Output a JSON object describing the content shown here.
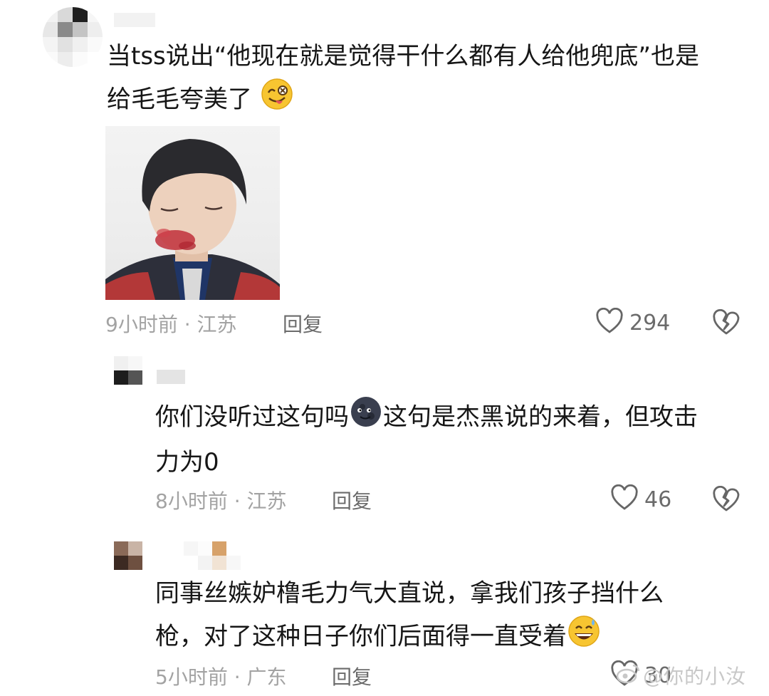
{
  "comments": [
    {
      "text_lines": [
        "当tss说出“他现在就是觉得干什么都有人给他兜底”也是",
        "给毛毛夸美了"
      ],
      "emoji": "yum-face-icon",
      "time": "9小时前",
      "location": "江苏",
      "reply_label": "回复",
      "likes": "294"
    },
    {
      "text_lines": [
        "你们没听过这句吗",
        "这句是杰黑说的来着，但攻击",
        "力为0"
      ],
      "emoji": "new-moon-face-icon",
      "time": "8小时前",
      "location": "江苏",
      "reply_label": "回复",
      "likes": "46"
    },
    {
      "text_lines": [
        "同事丝嫉妒橹毛力气大直说，拿我们孩子挡什么",
        "枪，对了这种日子你们后面得一直受着"
      ],
      "emoji": "grinning-sweat-face-icon",
      "time": "5小时前",
      "location": "广东",
      "reply_label": "回复",
      "likes": "30"
    }
  ],
  "separator": "·",
  "watermark": "@你的小汝"
}
